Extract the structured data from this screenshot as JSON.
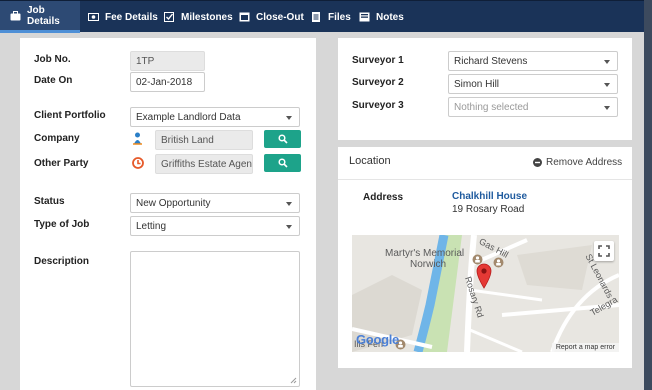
{
  "tabs": [
    {
      "label": "Job Details",
      "icon": "briefcase-icon",
      "active": true
    },
    {
      "label": "Fee Details",
      "icon": "money-icon",
      "active": false
    },
    {
      "label": "Milestones",
      "icon": "checkbox-icon",
      "active": false
    },
    {
      "label": "Close-Out",
      "icon": "window-icon",
      "active": false
    },
    {
      "label": "Files",
      "icon": "file-icon",
      "active": false
    },
    {
      "label": "Notes",
      "icon": "notes-icon",
      "active": false
    }
  ],
  "job": {
    "job_no_label": "Job No.",
    "job_no": "1TP",
    "date_on_label": "Date On",
    "date_on": "02-Jan-2018",
    "client_portfolio_label": "Client Portfolio",
    "client_portfolio": "Example Landlord Data",
    "company_label": "Company",
    "company": "British Land",
    "other_party_label": "Other Party",
    "other_party": "Griffiths Estate Agents",
    "status_label": "Status",
    "status": "New Opportunity",
    "type_label": "Type of Job",
    "type": "Letting",
    "description_label": "Description",
    "description": ""
  },
  "surveyors": {
    "s1_label": "Surveyor 1",
    "s1": "Richard Stevens",
    "s2_label": "Surveyor 2",
    "s2": "Simon Hill",
    "s3_label": "Surveyor 3",
    "s3_placeholder": "Nothing selected"
  },
  "location": {
    "title": "Location",
    "remove_label": "Remove Address",
    "address_label": "Address",
    "address_line1": "Chalkhill House",
    "address_line2": "19 Rosary Road"
  },
  "map": {
    "labels": {
      "poi1": "Martyr's Memorial",
      "poi2": "Norwich",
      "street1": "Gas Hill",
      "street2": "Rosary Rd",
      "street3": "St Leonards",
      "street4": "Telegra",
      "street5": "Ills Ferr",
      "google": "Google",
      "report": "Report a map error"
    },
    "colors": {
      "river": "#6fb5e8",
      "park": "#c9e2b3",
      "road": "#ffffff",
      "pin": "#e53935"
    }
  },
  "colors": {
    "tabbar": "#1a3358",
    "accent": "#1da38a",
    "link": "#1e5a9e"
  }
}
